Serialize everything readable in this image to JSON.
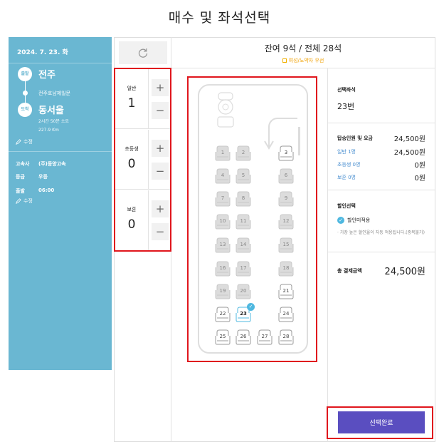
{
  "page": {
    "title": "매수 및 좌석선택"
  },
  "trip": {
    "date": "2024. 7. 23. 화",
    "depart_badge": "출발",
    "depart_city": "전주",
    "via": "전주호남제일문",
    "arrive_badge": "도착",
    "arrive_city": "동서울",
    "duration": "2시간 50분 소요",
    "distance": "227.9 Km",
    "edit_label": "수정",
    "company_label": "고속사",
    "company_value": "(주)동양고속",
    "grade_label": "등급",
    "grade_value": "우등",
    "depart_time_label": "출발",
    "depart_time_value": "06:00",
    "edit_label2": "수정"
  },
  "header": {
    "remaining": "잔여 9석 / 전체 28석",
    "legend_note": "여성/노약자 우선"
  },
  "counters": [
    {
      "label": "일반",
      "value": "1"
    },
    {
      "label": "초등생",
      "value": "0"
    },
    {
      "label": "보훈",
      "value": "0"
    }
  ],
  "seats": [
    {
      "num": "1",
      "state": "taken"
    },
    {
      "num": "2",
      "state": "taken"
    },
    {
      "num": "3",
      "state": "available"
    },
    {
      "num": "4",
      "state": "taken"
    },
    {
      "num": "5",
      "state": "taken"
    },
    {
      "num": "6",
      "state": "taken"
    },
    {
      "num": "7",
      "state": "taken"
    },
    {
      "num": "8",
      "state": "taken"
    },
    {
      "num": "9",
      "state": "taken"
    },
    {
      "num": "10",
      "state": "taken"
    },
    {
      "num": "11",
      "state": "taken"
    },
    {
      "num": "12",
      "state": "taken"
    },
    {
      "num": "13",
      "state": "taken"
    },
    {
      "num": "14",
      "state": "taken"
    },
    {
      "num": "15",
      "state": "taken"
    },
    {
      "num": "16",
      "state": "taken"
    },
    {
      "num": "17",
      "state": "taken"
    },
    {
      "num": "18",
      "state": "taken"
    },
    {
      "num": "19",
      "state": "taken"
    },
    {
      "num": "20",
      "state": "taken"
    },
    {
      "num": "21",
      "state": "available"
    },
    {
      "num": "22",
      "state": "available"
    },
    {
      "num": "23",
      "state": "selected"
    },
    {
      "num": "24",
      "state": "available"
    },
    {
      "num": "25",
      "state": "available"
    },
    {
      "num": "26",
      "state": "available"
    },
    {
      "num": "27",
      "state": "available"
    },
    {
      "num": "28",
      "state": "available"
    }
  ],
  "summary": {
    "selected_seat_title": "선택좌석",
    "selected_seat_value": "23번",
    "fare_title": "탑승인원 및 요금",
    "fare_total": "24,500원",
    "lines": [
      {
        "label": "일반 1명",
        "value": "24,500원"
      },
      {
        "label": "초등생 0명",
        "value": "0원"
      },
      {
        "label": "보훈 0명",
        "value": "0원"
      }
    ],
    "discount_title": "할인선택",
    "discount_option": "할인미적용",
    "discount_note": "· 가장 높은 할인율이 자동 적용됩니다.(중복불가)",
    "total_label": "총 결제금액",
    "total_value": "24,500원"
  },
  "actions": {
    "complete_label": "선택완료"
  },
  "colors": {
    "panel": "#6ab7d2",
    "accent": "#5a4ec0",
    "highlight": "#e0161d",
    "selected": "#4fb8e0"
  }
}
